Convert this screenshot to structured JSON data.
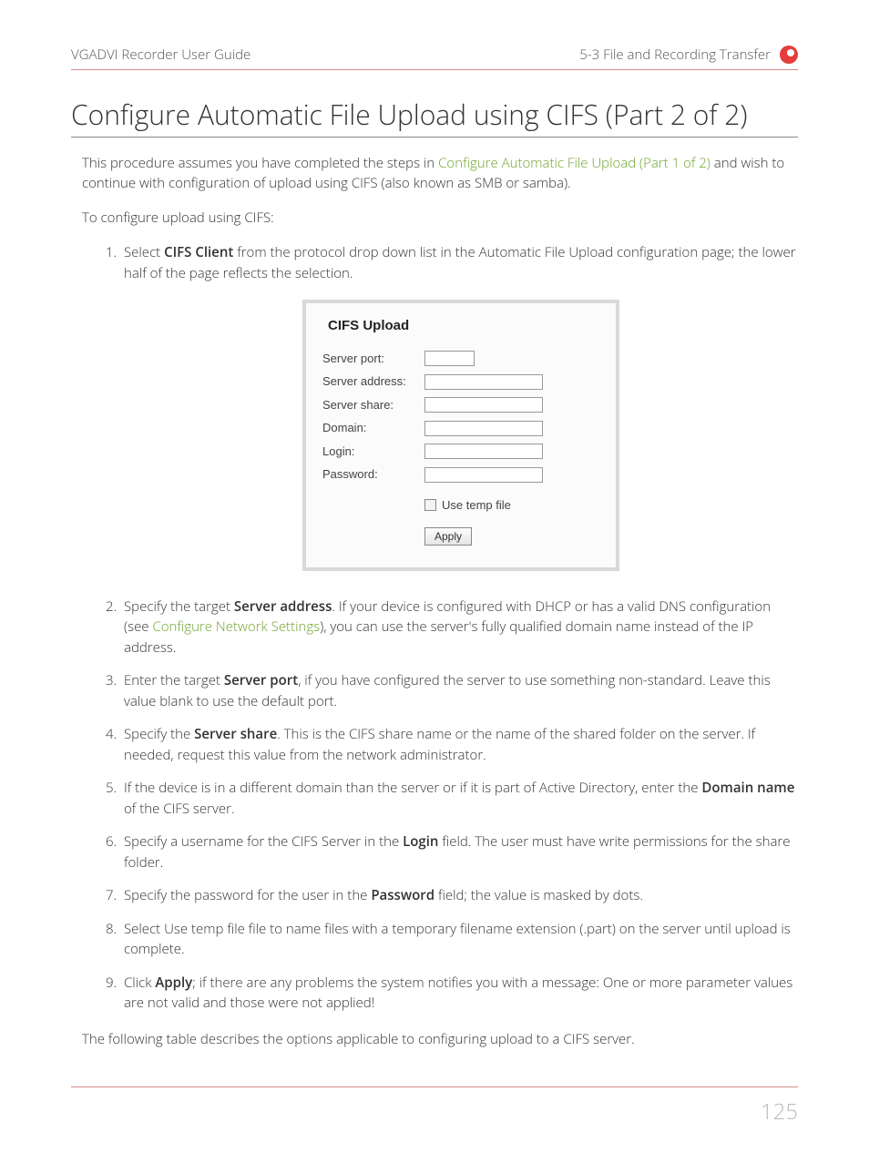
{
  "header": {
    "left": "VGADVI Recorder User Guide",
    "right": "5-3 File and Recording Transfer"
  },
  "title": "Configure Automatic File Upload using CIFS (Part 2 of 2)",
  "intro": {
    "pre": "This procedure assumes you have completed the steps in ",
    "link": "Configure Automatic File Upload (Part 1 of 2)",
    "post": " and wish to continue with configuration of upload using CIFS (also known as SMB or samba)."
  },
  "intro2": "To configure upload using CIFS:",
  "steps": {
    "s1a": "Select ",
    "s1b": "CIFS Client",
    "s1c": " from the protocol drop down list in the Automatic File Upload configuration page; the lower half of the page reflects the selection.",
    "s2a": "Specify the target ",
    "s2b": "Server address",
    "s2c": ". If your device is configured with DHCP or has a valid DNS configuration (see ",
    "s2link": "Configure Network Settings",
    "s2d": "), you can use the server's fully qualified domain name instead of the IP address.",
    "s3a": "Enter the target ",
    "s3b": "Server port",
    "s3c": ", if you have configured the server to use something non-standard. Leave this value blank to use the default port.",
    "s4a": "Specify the ",
    "s4b": "Server share",
    "s4c": ". This is the CIFS share name or the name of the shared folder on the server. If needed, request this value from the network administrator.",
    "s5a": "If the device is in a different domain than the server or if it is part of Active Directory, enter the ",
    "s5b": "Domain name",
    "s5c": " of the CIFS server.",
    "s6a": "Specify a username for the CIFS Server in the ",
    "s6b": "Login",
    "s6c": " field. The user must have write permissions for the share folder.",
    "s7a": "Specify the password for the user in the ",
    "s7b": "Password",
    "s7c": " field; the value is masked by dots.",
    "s8": "Select Use temp file file to name files with a temporary filename extension (.part) on the server until upload is complete.",
    "s9a": "Click ",
    "s9b": "Apply",
    "s9c": "; if there are any problems the system notifies you with a message: One or more parameter values are not valid and those were not applied!"
  },
  "form": {
    "title": "CIFS Upload",
    "labels": {
      "port": "Server port:",
      "address": "Server address:",
      "share": "Server share:",
      "domain": "Domain:",
      "login": "Login:",
      "password": "Password:"
    },
    "checkbox": "Use temp file",
    "apply": "Apply"
  },
  "closing": "The following table describes the options applicable to configuring upload to a CIFS server.",
  "page_number": "125"
}
